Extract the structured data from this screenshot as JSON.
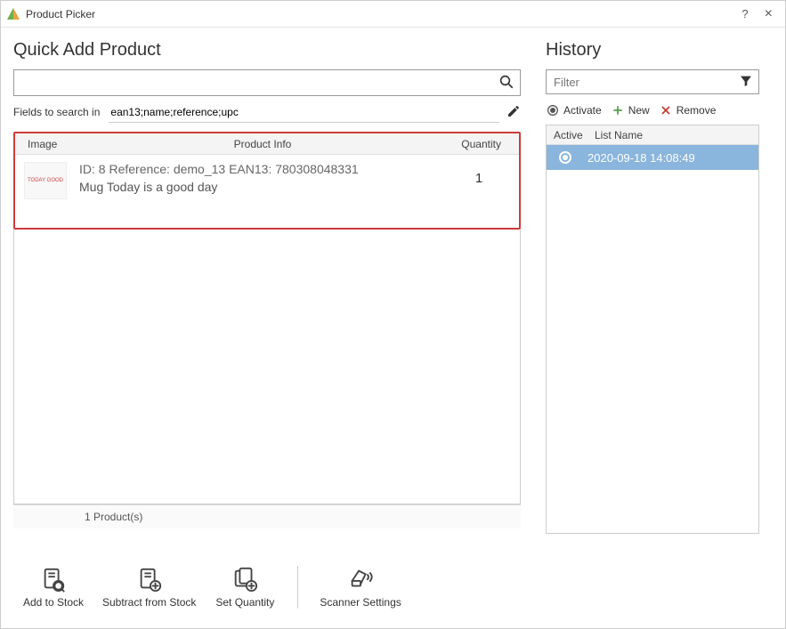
{
  "titlebar": {
    "title": "Product Picker",
    "help": "?",
    "close": "×"
  },
  "left": {
    "heading": "Quick Add Product",
    "searchPlaceholder": "",
    "fieldsLabel": "Fields to search in",
    "fieldsValue": "ean13;name;reference;upc",
    "columns": {
      "image": "Image",
      "info": "Product Info",
      "qty": "Quantity"
    },
    "row": {
      "line1": "ID: 8 Reference: demo_13 EAN13: 780308048331",
      "line2": "Mug Today is a good day",
      "imgText": "TODAY GOOD",
      "qty": "1"
    },
    "footer": "1 Product(s)"
  },
  "right": {
    "heading": "History",
    "filterPlaceholder": "Filter",
    "actions": {
      "activate": "Activate",
      "new": "New",
      "remove": "Remove"
    },
    "columns": {
      "active": "Active",
      "name": "List Name"
    },
    "items": [
      {
        "name": "2020-09-18 14:08:49",
        "active": true
      }
    ]
  },
  "bottom": {
    "addStock": "Add to Stock",
    "subStock": "Subtract from Stock",
    "setQty": "Set Quantity",
    "scanner": "Scanner Settings"
  }
}
